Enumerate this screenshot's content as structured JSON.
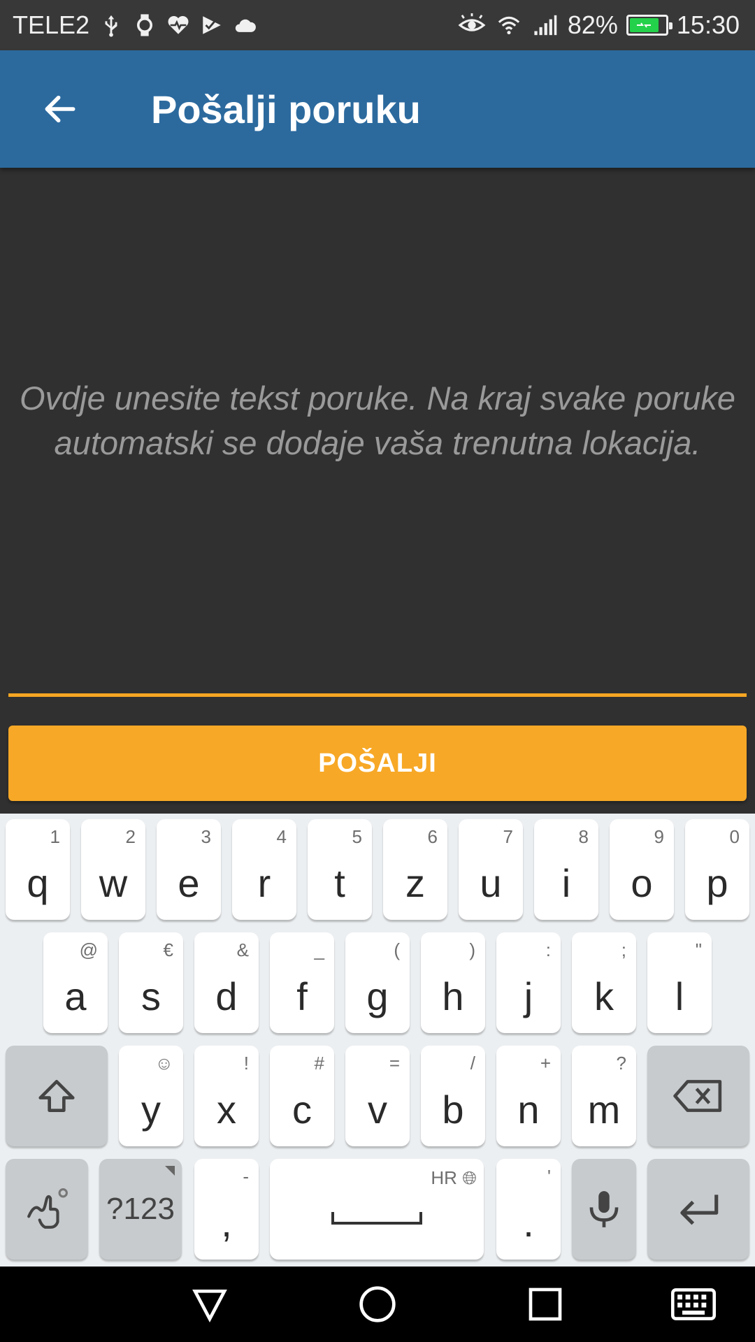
{
  "status_bar": {
    "carrier": "TELE2",
    "battery_percent": "82%",
    "battery_level": 0.82,
    "time": "15:30",
    "left_icons": [
      "usb-icon",
      "watch-icon",
      "heart-rate-icon",
      "checklist-icon",
      "cloud-icon"
    ],
    "right_icons": [
      "eye-icon",
      "wifi-icon",
      "signal-icon",
      "battery-icon"
    ]
  },
  "app_bar": {
    "title": "Pošalji poruku",
    "back_icon": "arrow-left-icon",
    "background": "#2c6a9e"
  },
  "message": {
    "placeholder": "Ovdje unesite tekst poruke. Na kraj svake poruke automatski se dodaje vaša trenutna lokacija.",
    "value": "",
    "underline_color": "#f5a623"
  },
  "send_button": {
    "label": "POŠALJI",
    "color": "#f7a826"
  },
  "keyboard": {
    "row1": [
      {
        "main": "q",
        "sub": "1"
      },
      {
        "main": "w",
        "sub": "2"
      },
      {
        "main": "e",
        "sub": "3"
      },
      {
        "main": "r",
        "sub": "4"
      },
      {
        "main": "t",
        "sub": "5"
      },
      {
        "main": "z",
        "sub": "6"
      },
      {
        "main": "u",
        "sub": "7"
      },
      {
        "main": "i",
        "sub": "8"
      },
      {
        "main": "o",
        "sub": "9"
      },
      {
        "main": "p",
        "sub": "0"
      }
    ],
    "row2": [
      {
        "main": "a",
        "sub": "@"
      },
      {
        "main": "s",
        "sub": "€"
      },
      {
        "main": "d",
        "sub": "&"
      },
      {
        "main": "f",
        "sub": "_"
      },
      {
        "main": "g",
        "sub": "("
      },
      {
        "main": "h",
        "sub": ")"
      },
      {
        "main": "j",
        "sub": ":"
      },
      {
        "main": "k",
        "sub": ";"
      },
      {
        "main": "l",
        "sub": "\""
      }
    ],
    "row3": [
      {
        "main": "y",
        "sub": "☺"
      },
      {
        "main": "x",
        "sub": "!"
      },
      {
        "main": "c",
        "sub": "#"
      },
      {
        "main": "v",
        "sub": "="
      },
      {
        "main": "b",
        "sub": "/"
      },
      {
        "main": "n",
        "sub": "+"
      },
      {
        "main": "m",
        "sub": "?"
      }
    ],
    "symbols_label": "?123",
    "comma": {
      "main": ",",
      "sub": "-"
    },
    "period": {
      "main": ".",
      "sub": "'"
    },
    "space_language": "HR",
    "icons": {
      "shift": "shift-icon",
      "backspace": "backspace-icon",
      "swipe": "swipe-gesture-icon",
      "mic": "microphone-icon",
      "enter": "enter-icon",
      "globe": "globe-icon"
    }
  },
  "nav_bar": {
    "icons": [
      "back-triangle-icon",
      "home-circle-icon",
      "recents-square-icon",
      "keyboard-icon"
    ]
  }
}
